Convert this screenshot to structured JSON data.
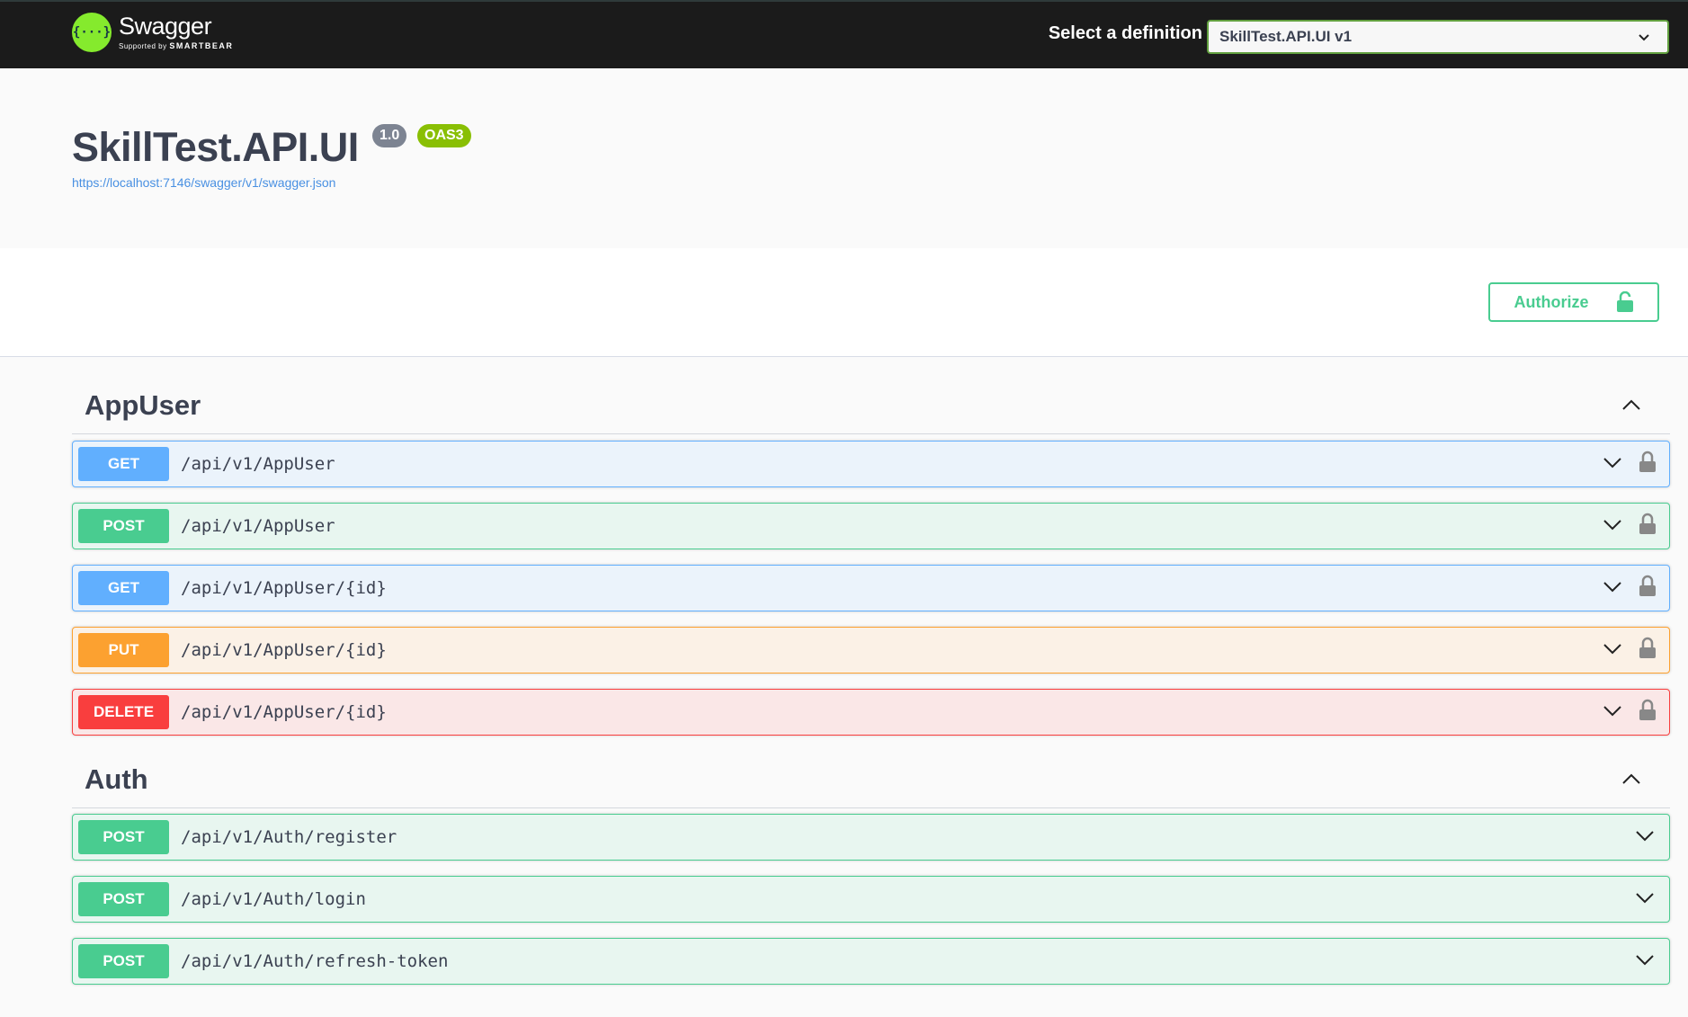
{
  "topbar": {
    "logo_name": "Swagger",
    "logo_supported_by": "Supported by",
    "logo_company": "SMARTBEAR",
    "logo_glyph": "{···}",
    "definition_label": "Select a definition",
    "definition_selected": "SkillTest.API.UI v1"
  },
  "info": {
    "title": "SkillTest.API.UI",
    "version": "1.0",
    "oas_badge": "OAS3",
    "spec_url": "https://localhost:7146/swagger/v1/swagger.json"
  },
  "authorize": {
    "label": "Authorize"
  },
  "tags": [
    {
      "name": "AppUser",
      "operations": [
        {
          "method": "GET",
          "path": "/api/v1/AppUser"
        },
        {
          "method": "POST",
          "path": "/api/v1/AppUser"
        },
        {
          "method": "GET",
          "path": "/api/v1/AppUser/{id}"
        },
        {
          "method": "PUT",
          "path": "/api/v1/AppUser/{id}"
        },
        {
          "method": "DELETE",
          "path": "/api/v1/AppUser/{id}"
        }
      ]
    },
    {
      "name": "Auth",
      "operations": [
        {
          "method": "POST",
          "path": "/api/v1/Auth/register"
        },
        {
          "method": "POST",
          "path": "/api/v1/Auth/login"
        },
        {
          "method": "POST",
          "path": "/api/v1/Auth/refresh-token"
        }
      ]
    }
  ],
  "colors": {
    "get": "#61affe",
    "post": "#49cc90",
    "put": "#fca130",
    "delete": "#f93e3e",
    "topbar": "#1b1b1b",
    "logo": "#85ea2d"
  },
  "icons": {
    "operation_lock": "lock-icon",
    "operation_expand": "chevron-down-icon",
    "tag_collapse": "chevron-up-icon",
    "authorize_lock": "unlocked-icon"
  }
}
